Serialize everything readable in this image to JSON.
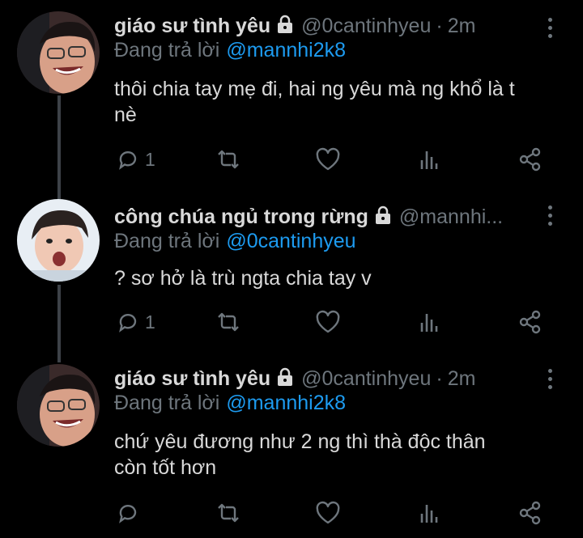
{
  "colors": {
    "background": "#000000",
    "text": "#d9d9d9",
    "muted": "#6e767d",
    "mention": "#1d9bf0",
    "thread_line": "#3d4248"
  },
  "reply_prefix": "Đang trả lời",
  "tweets": [
    {
      "display_name": "giáo sư tình yêu",
      "handle": "@0cantinhyeu",
      "separator": "·",
      "time": "2m",
      "reply_to": "@mannhi2k8",
      "text_lines": [
        "thôi chia tay mẹ đi, hai ng yêu mà ng khổ là t",
        "nè"
      ],
      "reply_count": "1",
      "icons": [
        "lock-icon",
        "more-icon",
        "reply-icon",
        "retweet-icon",
        "like-icon",
        "analytics-icon",
        "share-icon"
      ]
    },
    {
      "display_name": "công chúa ngủ trong rừng",
      "handle": "@mannhi...",
      "reply_to": "@0cantinhyeu",
      "text_lines": [
        "? sơ hở là trù ngta chia tay v"
      ],
      "reply_count": "1"
    },
    {
      "display_name": "giáo sư tình yêu",
      "handle": "@0cantinhyeu",
      "separator": "·",
      "time": "2m",
      "reply_to": "@mannhi2k8",
      "text_lines": [
        "chứ yêu đương như 2 ng thì thà độc thân",
        "còn tốt hơn"
      ],
      "reply_count": ""
    }
  ]
}
